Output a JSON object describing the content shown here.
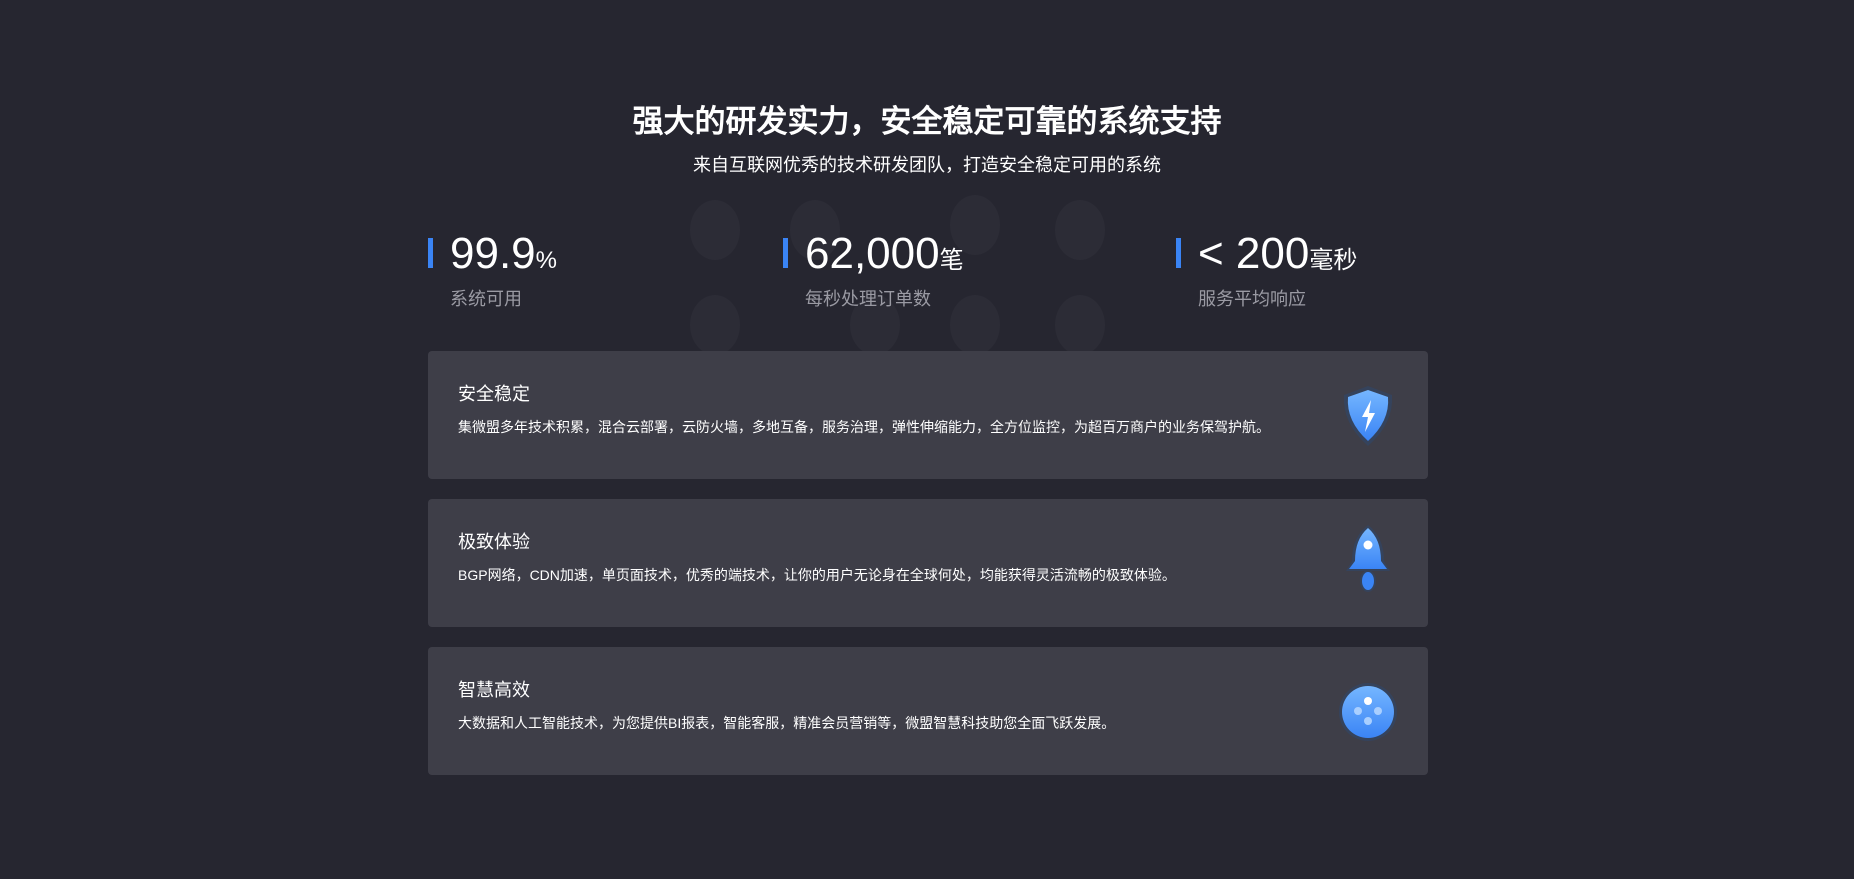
{
  "header": {
    "title": "强大的研发实力，安全稳定可靠的系统支持",
    "subtitle": "来自互联网优秀的技术研发团队，打造安全稳定可用的系统"
  },
  "stats": [
    {
      "value": "99.9",
      "unit": "%",
      "label": "系统可用"
    },
    {
      "value": "62,000",
      "unit": "笔",
      "label": "每秒处理订单数"
    },
    {
      "value": "< 200",
      "unit": "毫秒",
      "label": "服务平均响应"
    }
  ],
  "features": [
    {
      "title": "安全稳定",
      "desc": "集微盟多年技术积累，混合云部署，云防火墙，多地互备，服务治理，弹性伸缩能力，全方位监控，为超百万商户的业务保驾护航。",
      "icon": "shield-lightning-icon"
    },
    {
      "title": "极致体验",
      "desc": "BGP网络，CDN加速，单页面技术，优秀的端技术，让你的用户无论身在全球何处，均能获得灵活流畅的极致体验。",
      "icon": "rocket-icon"
    },
    {
      "title": "智慧高效",
      "desc": "大数据和人工智能技术，为您提供BI报表，智能客服，精准会员营销等，微盟智慧科技助您全面飞跃发展。",
      "icon": "smart-ball-icon"
    }
  ],
  "colors": {
    "background": "#262630",
    "card": "#3e3e48",
    "accent": "#3a84f5"
  }
}
